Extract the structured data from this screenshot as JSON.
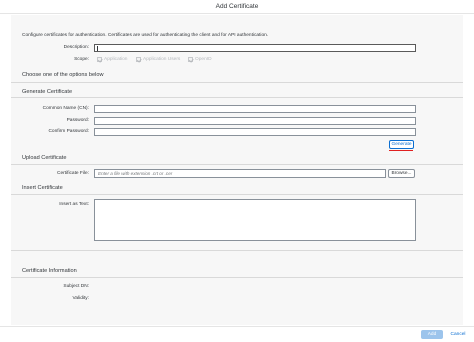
{
  "dialog": {
    "title": "Add Certificate"
  },
  "intro": "Configure certificates for authentication. Certificates are used for authenticating the client and for API authentication.",
  "description": {
    "label": "Description:",
    "value": ""
  },
  "scope": {
    "label": "Scope:",
    "options": [
      "Application",
      "Application Users",
      "OpenID"
    ]
  },
  "choose_heading": "Choose one of the options below",
  "generate": {
    "heading": "Generate Certificate",
    "common_name_label": "Common Name (CN):",
    "password_label": "Password:",
    "confirm_password_label": "Confirm Password:",
    "button": "Generate"
  },
  "upload": {
    "heading": "Upload Certificate",
    "file_label": "Certificate File:",
    "file_placeholder": "Enter a file with extension .crt or .cer",
    "browse_button": "Browse..."
  },
  "insert": {
    "heading": "Insert Certificate",
    "text_label": "Insert as Text:"
  },
  "info": {
    "heading": "Certificate Information",
    "subject_label": "Subject DN:",
    "validity_label": "Validity:"
  },
  "footer": {
    "add": "Add",
    "cancel": "Cancel"
  },
  "colors": {
    "accent": "#0a6ed1",
    "highlight": "#e02020",
    "disabled_button": "#9cc4ec"
  }
}
